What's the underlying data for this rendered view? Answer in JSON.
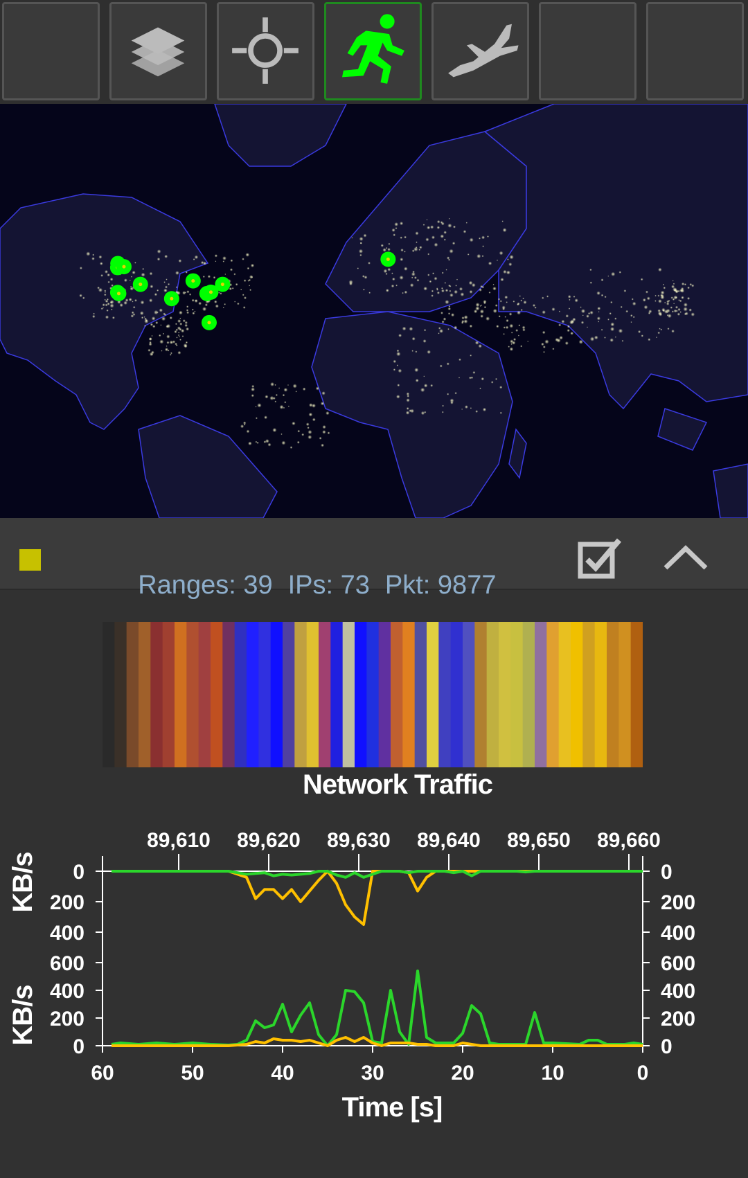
{
  "toolbar": {
    "buttons": [
      {
        "icon": "blank"
      },
      {
        "icon": "layers-icon"
      },
      {
        "icon": "crosshair-icon"
      },
      {
        "icon": "runner-icon",
        "active": true
      },
      {
        "icon": "airplane-icon"
      },
      {
        "icon": "blank"
      },
      {
        "icon": "blank"
      }
    ],
    "active_color": "#00ff00"
  },
  "map": {
    "markers": [
      {
        "lon": -122.3,
        "lat": 47.6
      },
      {
        "lon": -122.4,
        "lat": 46.3
      },
      {
        "lon": -119.5,
        "lat": 46.6
      },
      {
        "lon": -122.4,
        "lat": 37.8
      },
      {
        "lon": -121.9,
        "lat": 37.4
      },
      {
        "lon": -111.9,
        "lat": 40.7
      },
      {
        "lon": -97.5,
        "lat": 35.5
      },
      {
        "lon": -87.6,
        "lat": 41.9
      },
      {
        "lon": -81.2,
        "lat": 37.4
      },
      {
        "lon": -79.4,
        "lat": 37.9
      },
      {
        "lon": -74.0,
        "lat": 40.7
      },
      {
        "lon": -80.2,
        "lat": 26.0
      },
      {
        "lon": 2.35,
        "lat": 48.9
      }
    ],
    "marker_color": "#00ff00"
  },
  "status": {
    "ranges": "Ranges: 39",
    "ips": "IPs: 73",
    "pkt": "Pkt: 9877",
    "swatch_color": "#c7c100",
    "text_color": "#8eaecb"
  },
  "chart_data": {
    "type": "line",
    "title": "Network Traffic",
    "xlabel": "Time [s]",
    "ylabel": "KB/s",
    "top_axis_ticks": [
      "89,610",
      "89,620",
      "89,630",
      "89,640",
      "89,650",
      "89,660"
    ],
    "x_ticks": [
      60,
      50,
      40,
      30,
      20,
      10,
      0
    ],
    "xlim": [
      60,
      0
    ],
    "upper_panel": {
      "y_ticks": [
        0,
        200,
        400,
        600
      ],
      "ylim": [
        0,
        600
      ],
      "series": [
        {
          "color": "#ffc000",
          "x": [
            59,
            46,
            45,
            44,
            43,
            42,
            41,
            40,
            39,
            38,
            37,
            36,
            35,
            34,
            33,
            32,
            31,
            30,
            29,
            28,
            27,
            26,
            25,
            24,
            23,
            22,
            21,
            20,
            19,
            0
          ],
          "y": [
            0,
            0,
            20,
            40,
            180,
            120,
            120,
            180,
            120,
            200,
            130,
            60,
            0,
            80,
            220,
            300,
            350,
            0,
            0,
            0,
            0,
            10,
            130,
            40,
            0,
            0,
            0,
            0,
            0,
            0
          ]
        },
        {
          "color": "#2bd62b",
          "x": [
            59,
            46,
            45,
            44,
            43,
            42,
            41,
            40,
            39,
            38,
            37,
            36,
            35,
            34,
            33,
            32,
            31,
            30,
            29,
            28,
            27,
            26,
            25,
            24,
            23,
            22,
            21,
            20,
            19,
            18,
            17,
            16,
            15,
            14,
            13,
            12,
            11,
            10,
            5,
            0
          ],
          "y": [
            0,
            0,
            10,
            20,
            15,
            10,
            30,
            20,
            25,
            20,
            15,
            0,
            0,
            25,
            40,
            10,
            40,
            20,
            0,
            0,
            0,
            10,
            0,
            0,
            0,
            0,
            10,
            0,
            30,
            0,
            0,
            0,
            0,
            0,
            5,
            0,
            0,
            0,
            0,
            0
          ]
        }
      ]
    },
    "lower_panel": {
      "y_ticks": [
        0,
        200,
        400
      ],
      "ylim": [
        0,
        600
      ],
      "series": [
        {
          "color": "#2bd62b",
          "x": [
            59,
            58,
            56,
            54,
            52,
            50,
            48,
            46,
            45,
            44,
            43,
            42,
            41,
            40,
            39,
            38,
            37,
            36,
            35,
            34,
            33,
            32,
            31,
            30,
            29,
            28,
            27,
            26,
            25,
            24,
            23,
            22,
            21,
            20,
            19,
            18,
            17,
            16,
            14,
            13,
            12,
            11,
            10,
            7,
            6,
            5,
            4,
            2,
            1,
            0
          ],
          "y": [
            10,
            20,
            10,
            20,
            10,
            20,
            10,
            5,
            10,
            40,
            180,
            130,
            150,
            300,
            100,
            220,
            310,
            80,
            0,
            80,
            400,
            390,
            310,
            30,
            20,
            400,
            100,
            10,
            540,
            60,
            20,
            20,
            20,
            90,
            290,
            230,
            20,
            10,
            10,
            10,
            240,
            20,
            20,
            10,
            40,
            40,
            10,
            10,
            20,
            10
          ]
        },
        {
          "color": "#ffc000",
          "x": [
            59,
            46,
            45,
            44,
            43,
            42,
            41,
            40,
            39,
            38,
            37,
            36,
            35,
            34,
            33,
            32,
            31,
            30,
            29,
            28,
            27,
            26,
            25,
            24,
            23,
            22,
            21,
            20,
            19,
            18,
            17,
            0
          ],
          "y": [
            0,
            0,
            5,
            10,
            30,
            20,
            50,
            40,
            40,
            30,
            40,
            20,
            0,
            40,
            60,
            30,
            60,
            20,
            0,
            20,
            20,
            20,
            10,
            10,
            0,
            0,
            0,
            20,
            10,
            0,
            0,
            0
          ]
        }
      ]
    },
    "spectrum_colors": [
      "#2a2a2a",
      "#3a3028",
      "#7a4a2a",
      "#a0602a",
      "#8a3030",
      "#a04030",
      "#d07020",
      "#b05030",
      "#a04040",
      "#c05020",
      "#703060",
      "#3030c0",
      "#2020ff",
      "#3030e0",
      "#1010ff",
      "#5040a0",
      "#c0a040",
      "#e0c030",
      "#a04070",
      "#2020e0",
      "#c0c0a0",
      "#1010ff",
      "#2030e0",
      "#6030a0",
      "#c06030",
      "#e08020",
      "#5050a0",
      "#e0d040",
      "#4040c0",
      "#3030d0",
      "#5050c0",
      "#b08030",
      "#c0b040",
      "#d0c040",
      "#c8c040",
      "#b0b050",
      "#9070a0",
      "#e0a030",
      "#e8c020",
      "#f0c000",
      "#d0a020",
      "#e8b810",
      "#c08020",
      "#d09020",
      "#b06010"
    ]
  }
}
